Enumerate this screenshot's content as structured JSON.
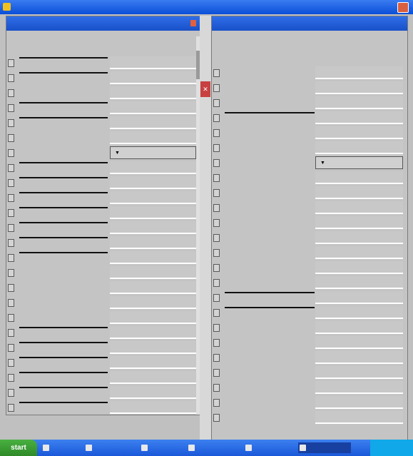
{
  "window": {
    "title": ""
  },
  "left_panel": {
    "title": "",
    "rows": [
      {
        "label": "",
        "value": "",
        "kind": "field",
        "bar": true
      },
      {
        "label": "",
        "value": "",
        "kind": "field",
        "bar": true
      },
      {
        "label": "",
        "value": "",
        "kind": "field",
        "bar": false
      },
      {
        "label": "",
        "value": "",
        "kind": "field",
        "bar": true
      },
      {
        "label": "",
        "value": "",
        "kind": "field",
        "bar": true
      },
      {
        "label": "",
        "value": "",
        "kind": "field",
        "bar": false
      },
      {
        "label": "",
        "value": "",
        "kind": "select",
        "bar": false
      },
      {
        "label": "",
        "value": "",
        "kind": "field",
        "bar": true
      },
      {
        "label": "",
        "value": "",
        "kind": "field",
        "bar": true
      },
      {
        "label": "",
        "value": "",
        "kind": "field",
        "bar": true
      },
      {
        "label": "",
        "value": "",
        "kind": "field",
        "bar": true
      },
      {
        "label": "",
        "value": "",
        "kind": "field",
        "bar": true
      },
      {
        "label": "",
        "value": "",
        "kind": "field",
        "bar": true
      },
      {
        "label": "",
        "value": "",
        "kind": "field",
        "bar": true
      },
      {
        "label": "",
        "value": "",
        "kind": "field",
        "bar": false
      },
      {
        "label": "",
        "value": "",
        "kind": "field",
        "bar": false
      },
      {
        "label": "",
        "value": "",
        "kind": "field",
        "bar": false
      },
      {
        "label": "",
        "value": "",
        "kind": "field",
        "bar": false
      },
      {
        "label": "",
        "value": "",
        "kind": "field",
        "bar": true
      },
      {
        "label": "",
        "value": "",
        "kind": "field",
        "bar": true
      },
      {
        "label": "",
        "value": "",
        "kind": "field",
        "bar": true
      },
      {
        "label": "",
        "value": "",
        "kind": "field",
        "bar": true
      },
      {
        "label": "",
        "value": "",
        "kind": "field",
        "bar": true
      },
      {
        "label": "",
        "value": "",
        "kind": "field",
        "bar": true
      }
    ]
  },
  "right_panel": {
    "title": "",
    "rows": [
      {
        "label": "",
        "value": "",
        "kind": "field",
        "bar": false
      },
      {
        "label": "",
        "value": "",
        "kind": "field",
        "bar": false
      },
      {
        "label": "",
        "value": "",
        "kind": "field",
        "bar": false
      },
      {
        "label": "",
        "value": "",
        "kind": "field",
        "bar": true
      },
      {
        "label": "",
        "value": "",
        "kind": "field",
        "bar": false
      },
      {
        "label": "",
        "value": "",
        "kind": "field",
        "bar": false
      },
      {
        "label": "",
        "value": "",
        "kind": "select",
        "bar": false
      },
      {
        "label": "",
        "value": "",
        "kind": "field",
        "bar": false
      },
      {
        "label": "",
        "value": "",
        "kind": "field",
        "bar": false
      },
      {
        "label": "",
        "value": "",
        "kind": "field",
        "bar": false
      },
      {
        "label": "",
        "value": "",
        "kind": "field",
        "bar": false
      },
      {
        "label": "",
        "value": "",
        "kind": "field",
        "bar": false
      },
      {
        "label": "",
        "value": "",
        "kind": "field",
        "bar": false
      },
      {
        "label": "",
        "value": "",
        "kind": "field",
        "bar": false
      },
      {
        "label": "",
        "value": "",
        "kind": "field",
        "bar": false
      },
      {
        "label": "",
        "value": "",
        "kind": "field",
        "bar": true
      },
      {
        "label": "",
        "value": "",
        "kind": "field",
        "bar": true
      },
      {
        "label": "",
        "value": "",
        "kind": "field",
        "bar": false
      },
      {
        "label": "",
        "value": "",
        "kind": "field",
        "bar": false
      },
      {
        "label": "",
        "value": "",
        "kind": "field",
        "bar": false
      },
      {
        "label": "",
        "value": "",
        "kind": "field",
        "bar": false
      },
      {
        "label": "",
        "value": "",
        "kind": "field",
        "bar": false
      },
      {
        "label": "",
        "value": "",
        "kind": "field",
        "bar": false
      },
      {
        "label": "",
        "value": "",
        "kind": "field",
        "bar": false
      }
    ]
  },
  "taskbar": {
    "start_label": "start",
    "items": [
      "",
      "",
      "",
      "",
      "",
      "",
      ""
    ],
    "clock": ""
  },
  "colors": {
    "titlebar": "#0a4fd8",
    "taskbar": "#1a58d8",
    "start": "#2f8a28",
    "panel_bg": "#c4c4c4"
  }
}
